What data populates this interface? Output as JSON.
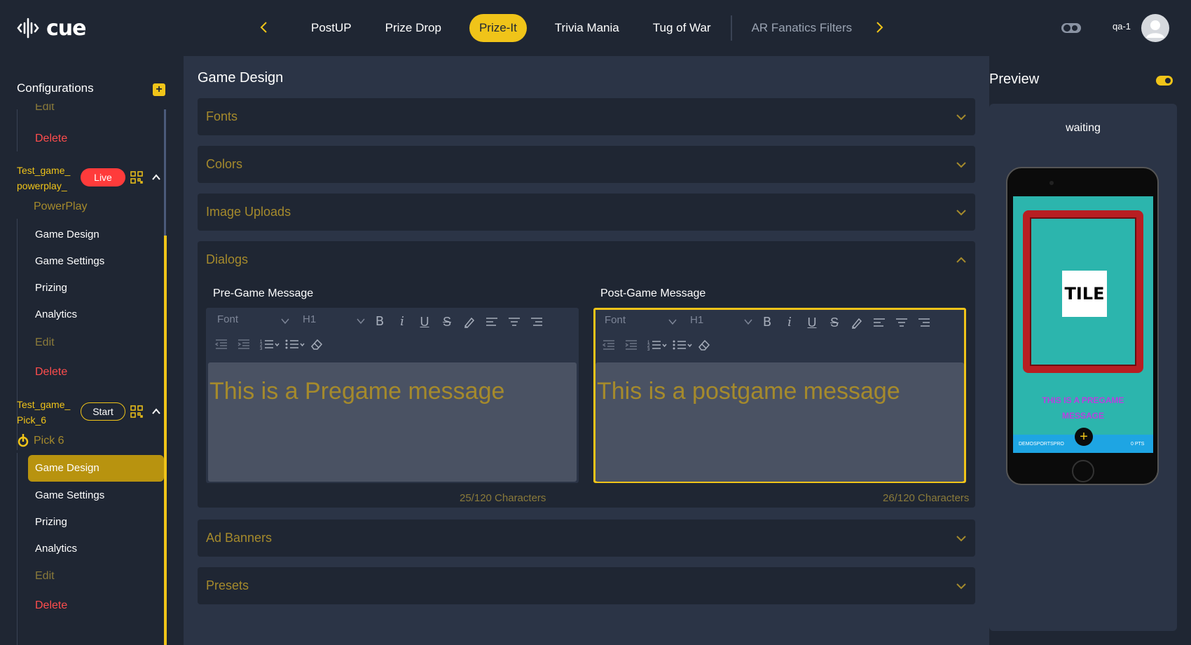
{
  "app": {
    "logo_text": "cue"
  },
  "header": {
    "tabs": [
      {
        "label": "PostUP"
      },
      {
        "label": "Prize Drop"
      },
      {
        "label": "Prize-It"
      },
      {
        "label": "Trivia Mania"
      },
      {
        "label": "Tug of War"
      },
      {
        "label": "AR Fanatics Filters"
      }
    ],
    "active_tab": "Prize-It",
    "user_name": "qa-1"
  },
  "sidebar": {
    "title": "Configurations",
    "add_label": "+",
    "top_items": [
      {
        "label": "Edit"
      },
      {
        "label": "Delete"
      }
    ],
    "games": [
      {
        "name_line1": "Test_game_",
        "name_line2": "powerplay_",
        "badge": "Live",
        "type": "PowerPlay",
        "items": [
          "Game Design",
          "Game Settings",
          "Prizing",
          "Analytics"
        ],
        "edit": "Edit",
        "delete": "Delete"
      },
      {
        "name_line1": "Test_game_",
        "name_line2": "Pick_6",
        "badge": "Start",
        "type": "Pick 6",
        "items": [
          "Game Design",
          "Game Settings",
          "Prizing",
          "Analytics"
        ],
        "edit": "Edit",
        "delete": "Delete"
      }
    ]
  },
  "main": {
    "title": "Game Design",
    "sections": {
      "fonts": "Fonts",
      "colors": "Colors",
      "image_uploads": "Image Uploads",
      "dialogs": "Dialogs",
      "ad_banners": "Ad Banners",
      "presets": "Presets"
    },
    "dialogs": {
      "pre": {
        "label": "Pre-Game Message",
        "font_placeholder": "Font",
        "heading": "H1",
        "text": "This is a Pregame message",
        "count": "25/120 Characters"
      },
      "post": {
        "label": "Post-Game Message",
        "font_placeholder": "Font",
        "heading": "H1",
        "text": "This is a postgame message",
        "count": "26/120 Characters"
      }
    }
  },
  "preview": {
    "title": "Preview",
    "status": "waiting",
    "tile_text": "TILE",
    "phone_message_line1": "THIS IS A PREGAME",
    "phone_message_line2": "MESSAGE",
    "phone_user": "DEMOSPORTSPRO",
    "phone_points": "0 PTS"
  },
  "colors": {
    "accent": "#f0c419",
    "background": "#1f2633",
    "panel": "#2b3446",
    "danger": "#ff4d4d"
  }
}
